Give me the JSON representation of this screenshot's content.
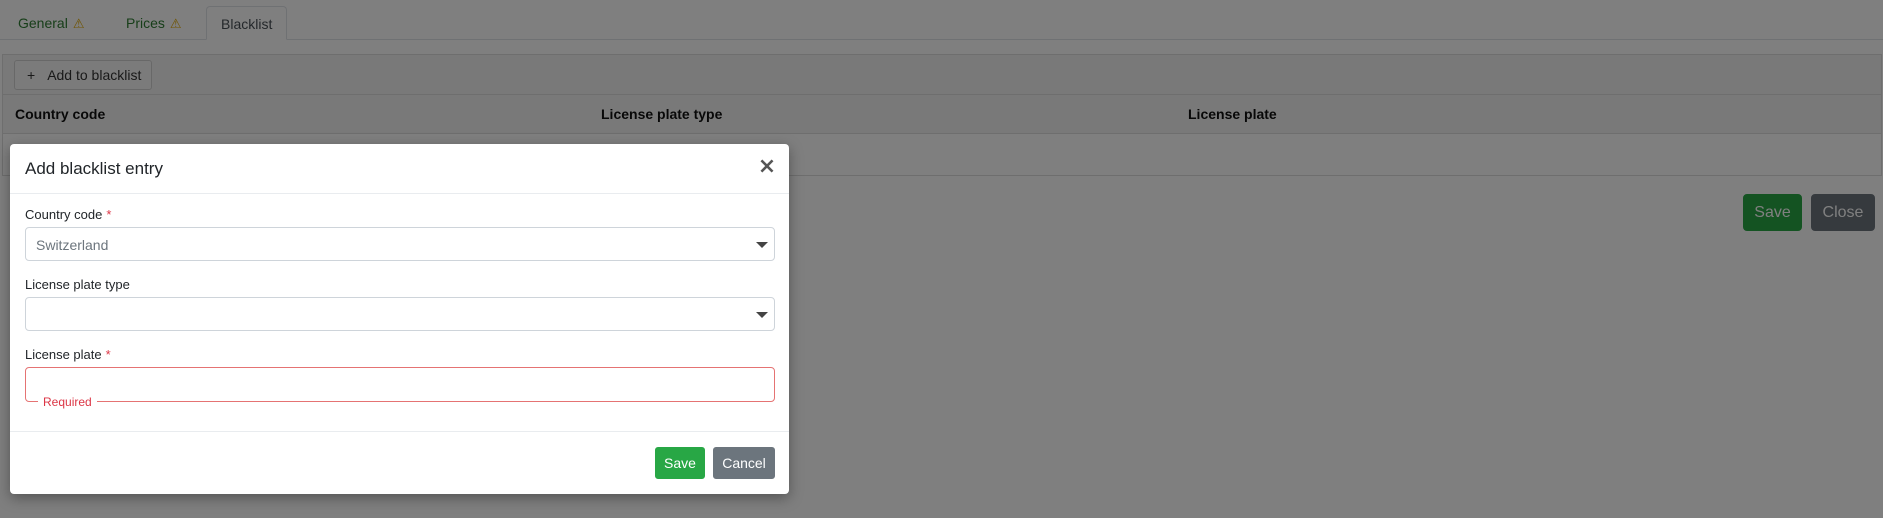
{
  "tabs": [
    {
      "label": "General",
      "warning_icon": "warning-triangle-icon"
    },
    {
      "label": "Prices",
      "warning_icon": "warning-triangle-icon"
    },
    {
      "label": "Blacklist"
    }
  ],
  "toolbar": {
    "add_label": "Add to blacklist",
    "add_icon": "plus-icon"
  },
  "grid": {
    "columns": [
      "Country code",
      "License plate type",
      "License plate"
    ]
  },
  "page_actions": {
    "save_label": "Save",
    "close_label": "Close"
  },
  "modal": {
    "title": "Add blacklist entry",
    "close_icon": "close-icon",
    "country_code": {
      "label": "Country code",
      "required_mark": "*",
      "value": "Switzerland"
    },
    "plate_type": {
      "label": "License plate type",
      "value": ""
    },
    "license_plate": {
      "label": "License plate",
      "required_mark": "*",
      "value": "",
      "error": "Required"
    },
    "save_label": "Save",
    "cancel_label": "Cancel"
  },
  "colors": {
    "success": "#28a745",
    "secondary": "#6c757d",
    "danger": "#dc3545",
    "warning": "#e0a800"
  }
}
